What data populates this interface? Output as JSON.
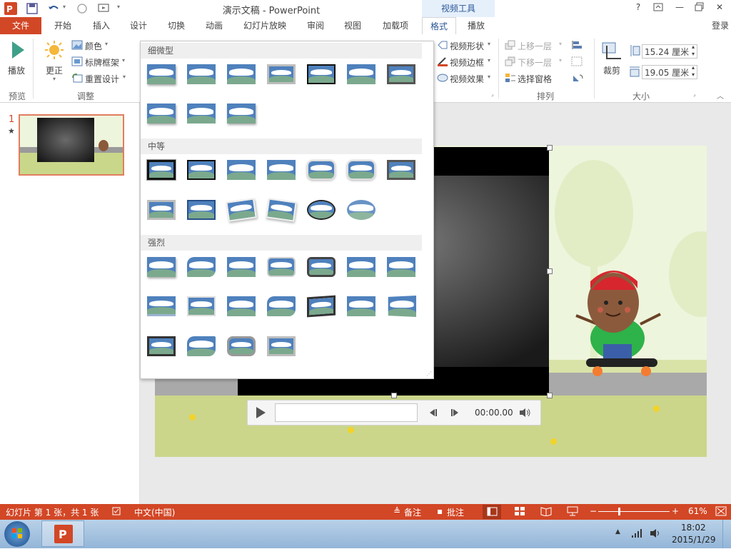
{
  "window": {
    "title": "演示文稿 - PowerPoint",
    "context_header": "视频工具",
    "signin": "登录"
  },
  "tabs": [
    "文件",
    "开始",
    "插入",
    "设计",
    "切换",
    "动画",
    "幻灯片放映",
    "审阅",
    "视图",
    "加载项",
    "格式",
    "播放"
  ],
  "ribbon": {
    "play_label": "播放",
    "preview_group": "预览",
    "correct_label": "更正",
    "color_label": "颜色",
    "poster_label": "标牌框架",
    "reset_label": "重置设计",
    "adjust_group": "调整",
    "video_shape": "视频形状",
    "video_border": "视频边框",
    "video_effects": "视频效果",
    "bring_forward": "上移一层",
    "send_backward": "下移一层",
    "selection_pane": "选择窗格",
    "arrange_group": "排列",
    "crop_label": "裁剪",
    "height_value": "15.24 厘米",
    "width_value": "19.05 厘米",
    "size_group": "大小"
  },
  "gallery": {
    "section_subtle": "细微型",
    "section_moderate": "中等",
    "section_intense": "强烈"
  },
  "thumbnail": {
    "number": "1",
    "star": "★"
  },
  "player": {
    "time": "00:00.00"
  },
  "status": {
    "slide_info": "幻灯片 第 1 张，共 1 张",
    "language": "中文(中国)",
    "notes": "备注",
    "comments": "批注",
    "zoom": "61%"
  },
  "taskbar": {
    "time": "18:02",
    "date": "2015/1/29"
  },
  "colors": {
    "accent": "#d24726",
    "context": "#2b5797",
    "tab_active_text": "#2b5797"
  }
}
